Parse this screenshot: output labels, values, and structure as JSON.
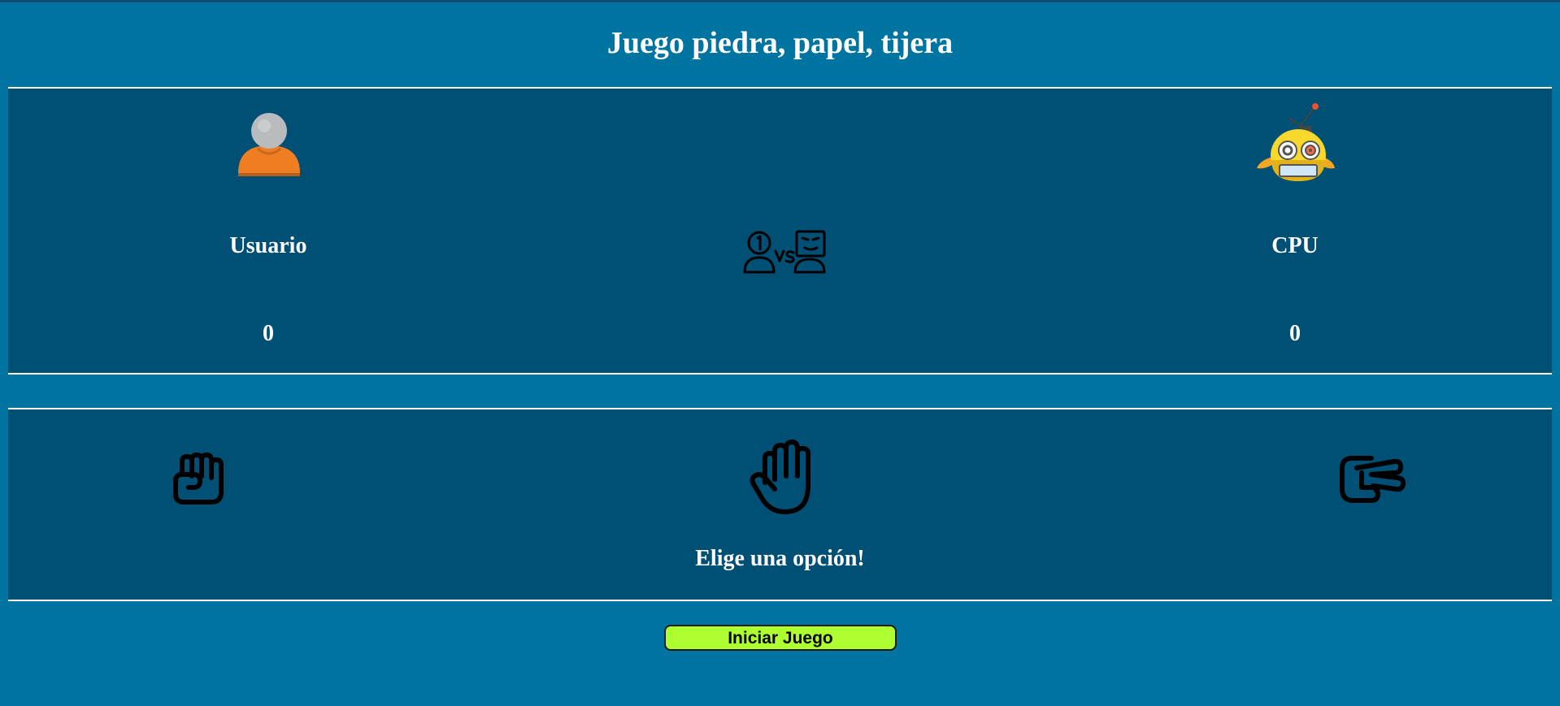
{
  "page": {
    "title": "Juego piedra, papel, tijera"
  },
  "scoreboard": {
    "user": {
      "label": "Usuario",
      "score": "0",
      "avatar_icon": "user-avatar-icon"
    },
    "versus_icon": "versus-icon",
    "cpu": {
      "label": "CPU",
      "score": "0",
      "avatar_icon": "robot-icon"
    }
  },
  "choices": {
    "options": [
      {
        "name": "piedra",
        "icon": "rock-fist-icon"
      },
      {
        "name": "papel",
        "icon": "paper-hand-icon"
      },
      {
        "name": "tijera",
        "icon": "scissors-hand-icon"
      }
    ],
    "message": "Elige una opción!"
  },
  "actions": {
    "start_label": "Iniciar Juego"
  },
  "colors": {
    "background": "#0074a1",
    "panel": "#004f74",
    "button": "#adff2f"
  }
}
